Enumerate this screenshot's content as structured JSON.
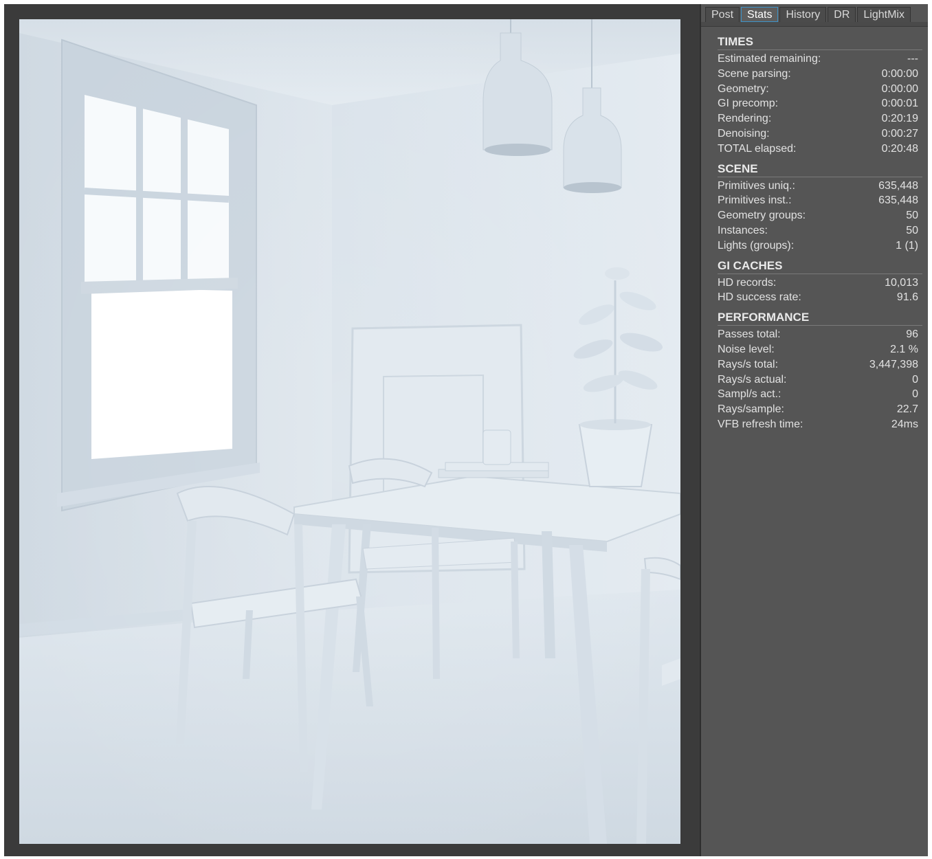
{
  "tabs": [
    {
      "label": "Post",
      "active": false
    },
    {
      "label": "Stats",
      "active": true
    },
    {
      "label": "History",
      "active": false
    },
    {
      "label": "DR",
      "active": false
    },
    {
      "label": "LightMix",
      "active": false
    }
  ],
  "colors": {
    "panel_bg": "#555555",
    "active_tab_border": "#3e94c9",
    "text": "#e2e2e2"
  },
  "stats": {
    "times": {
      "title": "TIMES",
      "rows": [
        {
          "label": "Estimated remaining:",
          "value": "---"
        },
        {
          "label": "Scene parsing:",
          "value": "0:00:00"
        },
        {
          "label": "Geometry:",
          "value": "0:00:00"
        },
        {
          "label": "GI precomp:",
          "value": "0:00:01"
        },
        {
          "label": "Rendering:",
          "value": "0:20:19"
        },
        {
          "label": "Denoising:",
          "value": "0:00:27"
        },
        {
          "label": "TOTAL elapsed:",
          "value": "0:20:48"
        }
      ]
    },
    "scene": {
      "title": "SCENE",
      "rows": [
        {
          "label": "Primitives uniq.:",
          "value": "635,448"
        },
        {
          "label": "Primitives inst.:",
          "value": "635,448"
        },
        {
          "label": "Geometry groups:",
          "value": "50"
        },
        {
          "label": "Instances:",
          "value": "50"
        },
        {
          "label": "Lights (groups):",
          "value": "1 (1)"
        }
      ]
    },
    "gi_caches": {
      "title": "GI CACHES",
      "rows": [
        {
          "label": "HD records:",
          "value": "10,013"
        },
        {
          "label": "HD success rate:",
          "value": "91.6"
        }
      ]
    },
    "performance": {
      "title": "PERFORMANCE",
      "rows": [
        {
          "label": "Passes total:",
          "value": "96"
        },
        {
          "label": "Noise level:",
          "value": "2.1 %"
        },
        {
          "label": "Rays/s total:",
          "value": "3,447,398"
        },
        {
          "label": "Rays/s actual:",
          "value": "0"
        },
        {
          "label": "Sampl/s act.:",
          "value": "0"
        },
        {
          "label": "Rays/sample:",
          "value": "22.7"
        },
        {
          "label": "VFB refresh time:",
          "value": "24ms"
        }
      ]
    }
  }
}
